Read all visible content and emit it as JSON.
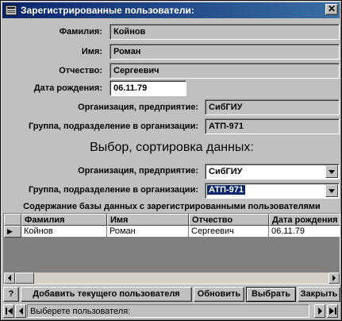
{
  "window": {
    "title": "Зарегистрированные пользователи:",
    "close_glyph": "✕"
  },
  "form": {
    "surname_label": "Фамилия:",
    "surname_value": "Койнов",
    "name_label": "Имя:",
    "name_value": "Роман",
    "patronymic_label": "Отчество:",
    "patronymic_value": "Сергеевич",
    "birthdate_label": "Дата рождения:",
    "birthdate_value": "06.11.79",
    "org_label": "Организация, предприятие:",
    "org_value": "СибГИУ",
    "group_label": "Группа, подразделение в организации:",
    "group_value": "АТП-971"
  },
  "selection": {
    "heading": "Выбор, сортировка данных:",
    "org_label": "Организация, предприятие:",
    "org_selected": "СибГИУ",
    "group_label": "Группа, подразделение в организации:",
    "group_selected": "АТП-971"
  },
  "grid": {
    "title": "Содержание базы данных с зарегистрированными пользователями",
    "columns": [
      "Фамилия",
      "Имя",
      "Отчество",
      "Дата рождения"
    ],
    "rows": [
      {
        "indicator": "▶",
        "cells": [
          "Койнов",
          "Роман",
          "Сергеевич",
          "06.11.79"
        ]
      }
    ]
  },
  "buttons": {
    "help": "?",
    "add_current_user": "Добавить текущего пользователя",
    "refresh": "Обновить",
    "select": "Выбрать",
    "close": "Закрыть"
  },
  "status": {
    "text": "Выберете пользователя:"
  },
  "colors": {
    "titlebar_start": "#0a246a",
    "titlebar_end": "#3a6ea5",
    "face": "#c0c0c0",
    "selection": "#0a246a"
  }
}
